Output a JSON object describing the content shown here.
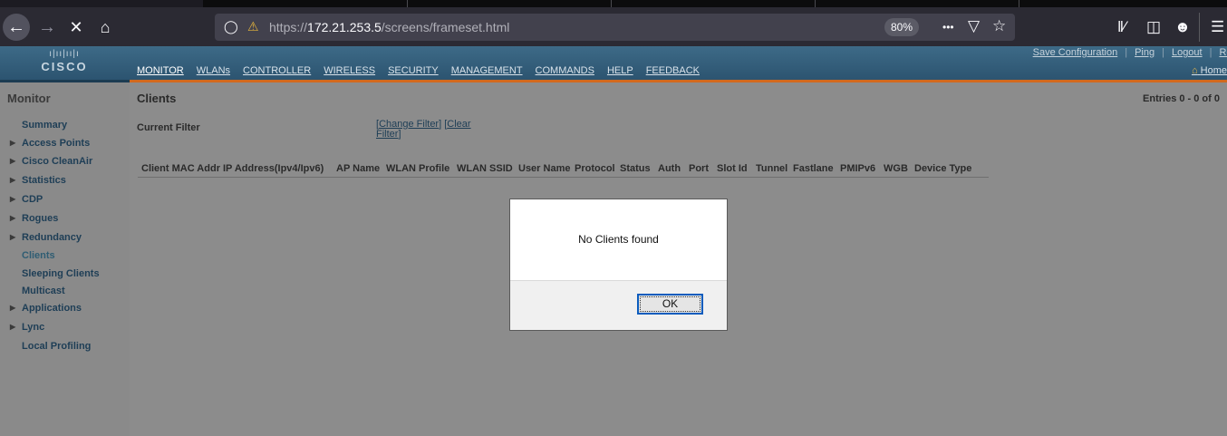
{
  "browser": {
    "url_prefix": "https://",
    "url_host": "172.21.253.5",
    "url_path": "/screens/frameset.html",
    "zoom": "80%",
    "page_actions_icon": "•••"
  },
  "header": {
    "logo_text": "CISCO",
    "nav": [
      "MONITOR",
      "WLANs",
      "CONTROLLER",
      "WIRELESS",
      "SECURITY",
      "MANAGEMENT",
      "COMMANDS",
      "HELP",
      "FEEDBACK"
    ],
    "active_nav": "MONITOR",
    "top_links": [
      "Save Configuration",
      "Ping",
      "Logout",
      "Refresh"
    ],
    "home_link": "Home"
  },
  "sidebar": {
    "title": "Monitor",
    "items": [
      {
        "label": "Summary",
        "expandable": false
      },
      {
        "label": "Access Points",
        "expandable": true
      },
      {
        "label": "Cisco CleanAir",
        "expandable": true
      },
      {
        "label": "Statistics",
        "expandable": true
      },
      {
        "label": "CDP",
        "expandable": true
      },
      {
        "label": "Rogues",
        "expandable": true
      },
      {
        "label": "Redundancy",
        "expandable": true
      },
      {
        "label": "Clients",
        "expandable": false,
        "current": true
      },
      {
        "label": "Sleeping Clients",
        "expandable": false
      },
      {
        "label": "Multicast",
        "expandable": false
      },
      {
        "label": "Applications",
        "expandable": true
      },
      {
        "label": "Lync",
        "expandable": true
      },
      {
        "label": "Local Profiling",
        "expandable": false
      }
    ]
  },
  "main": {
    "heading": "Clients",
    "entries": "Entries 0 - 0 of 0",
    "filter_label": "Current Filter",
    "change_filter": "Change Filter",
    "clear_filter": "Clear Filter",
    "columns": [
      "Client MAC Addr",
      "IP Address(Ipv4/Ipv6)",
      "AP Name",
      "WLAN Profile",
      "WLAN SSID",
      "User Name",
      "Protocol",
      "Status",
      "Auth",
      "Port",
      "Slot Id",
      "Tunnel",
      "Fastlane",
      "PMIPv6",
      "WGB",
      "Device Type"
    ]
  },
  "dialog": {
    "message": "No Clients found",
    "ok_label": "OK"
  }
}
